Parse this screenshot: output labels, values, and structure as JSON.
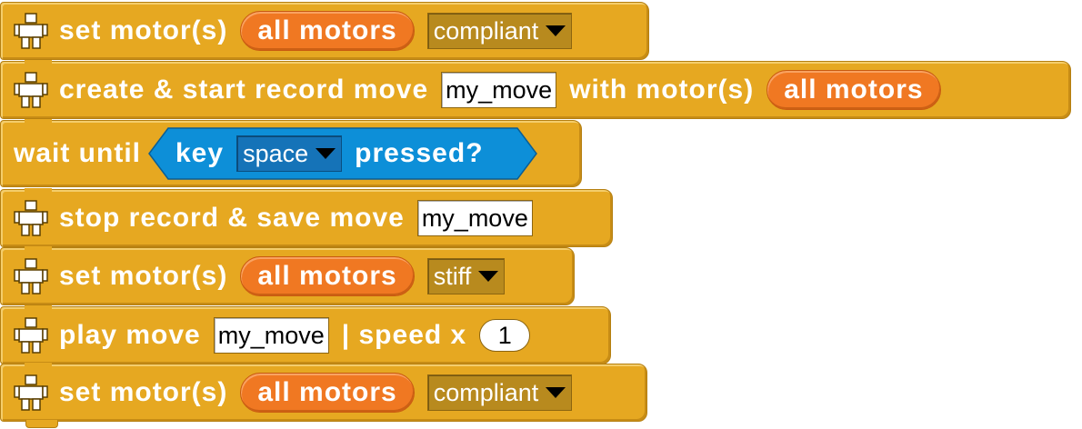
{
  "colors": {
    "block": "#E6A821",
    "motor_reporter": "#F07822",
    "sensing_predicate": "#0D8FD8",
    "dropdown": "#B88A1E"
  },
  "icon": "robot-icon",
  "blocks": [
    {
      "word1": "set motor(s)",
      "reporter": "all motors",
      "dropdown": "compliant"
    },
    {
      "word1": "create & start record move",
      "field": "my_move",
      "word2": "with motor(s)",
      "reporter": "all motors"
    },
    {
      "word1": "wait until",
      "pred_key": "key",
      "pred_dropdown": "space",
      "pred_word": "pressed?"
    },
    {
      "word1": "stop record & save move",
      "field": "my_move"
    },
    {
      "word1": "set motor(s)",
      "reporter": "all motors",
      "dropdown": "stiff"
    },
    {
      "word1": "play move",
      "field": "my_move",
      "word2": "| speed x",
      "number": "1"
    },
    {
      "word1": "set motor(s)",
      "reporter": "all motors",
      "dropdown": "compliant"
    }
  ]
}
